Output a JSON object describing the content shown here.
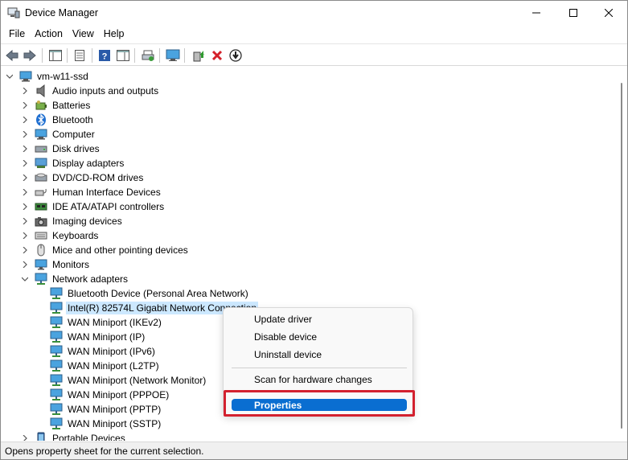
{
  "window": {
    "title": "Device Manager",
    "minimize_icon": "minimize-icon",
    "maximize_icon": "maximize-icon",
    "close_icon": "close-icon"
  },
  "menubar": {
    "items": [
      "File",
      "Action",
      "View",
      "Help"
    ]
  },
  "toolbar": {
    "buttons": [
      "back-icon",
      "forward-icon",
      "show-hide-console-tree-icon",
      "properties-icon",
      "help-icon",
      "action-pane-icon",
      "print-icon",
      "display-computer-icon",
      "update-driver-icon",
      "uninstall-icon",
      "disable-device-icon"
    ]
  },
  "tree": {
    "root": "vm-w11-ssd",
    "categories": [
      "Audio inputs and outputs",
      "Batteries",
      "Bluetooth",
      "Computer",
      "Disk drives",
      "Display adapters",
      "DVD/CD-ROM drives",
      "Human Interface Devices",
      "IDE ATA/ATAPI controllers",
      "Imaging devices",
      "Keyboards",
      "Mice and other pointing devices",
      "Monitors",
      "Network adapters"
    ],
    "network_children": [
      "Bluetooth Device (Personal Area Network)",
      "Intel(R) 82574L Gigabit Network Connection",
      "WAN Miniport (IKEv2)",
      "WAN Miniport (IP)",
      "WAN Miniport (IPv6)",
      "WAN Miniport (L2TP)",
      "WAN Miniport (Network Monitor)",
      "WAN Miniport (PPPOE)",
      "WAN Miniport (PPTP)",
      "WAN Miniport (SSTP)"
    ],
    "after": "Portable Devices",
    "selected": "Intel(R) 82574L Gigabit Network Connection"
  },
  "context_menu": {
    "items": [
      "Update driver",
      "Disable device",
      "Uninstall device",
      "Scan for hardware changes",
      "Properties"
    ],
    "highlighted": "Properties",
    "highlight_color": "#0a6ed1",
    "annotation_box_color": "#d3212f"
  },
  "status": {
    "text": "Opens property sheet for the current selection."
  }
}
